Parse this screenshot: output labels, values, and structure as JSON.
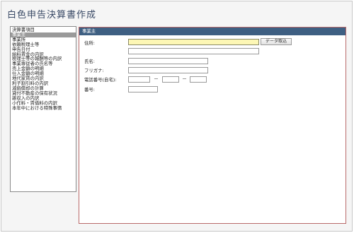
{
  "app": {
    "title": "白色申告決算書作成"
  },
  "sidebar": {
    "items": [
      {
        "label": "決算書項目",
        "selected": false
      },
      {
        "label": "事業主",
        "selected": true
      },
      {
        "label": "事業所",
        "selected": false
      },
      {
        "label": "依頼税理士等",
        "selected": false
      },
      {
        "label": "申告日付",
        "selected": false
      },
      {
        "label": "給料賃金の内訳",
        "selected": false
      },
      {
        "label": "税理士等の報酬等の内訳",
        "selected": false
      },
      {
        "label": "事業専従者の氏名等",
        "selected": false
      },
      {
        "label": "売上金額の明細",
        "selected": false
      },
      {
        "label": "仕入金額の明細",
        "selected": false
      },
      {
        "label": "地代家賃の内訳",
        "selected": false
      },
      {
        "label": "利子割引料の内訳",
        "selected": false
      },
      {
        "label": "減価償却の計算",
        "selected": false
      },
      {
        "label": "貸付不動産の保有状況",
        "selected": false
      },
      {
        "label": "雑収入の内訳",
        "selected": false
      },
      {
        "label": "小作料・賃借料の内訳",
        "selected": false
      },
      {
        "label": "本年中における特殊事情",
        "selected": false
      }
    ]
  },
  "panel": {
    "header": "事業主",
    "address_label": "住所:",
    "address_value": "",
    "address_line2_value": "",
    "fetch_button": "データ取込",
    "name_label": "氏名:",
    "name_value": "",
    "furigana_label": "フリガナ:",
    "furigana_value": "",
    "phone_label": "電話番号(自宅):",
    "phone_part1": "",
    "phone_part2": "",
    "phone_part3": "",
    "phone_separator": "－",
    "number_label": "番号:",
    "number_value": ""
  }
}
